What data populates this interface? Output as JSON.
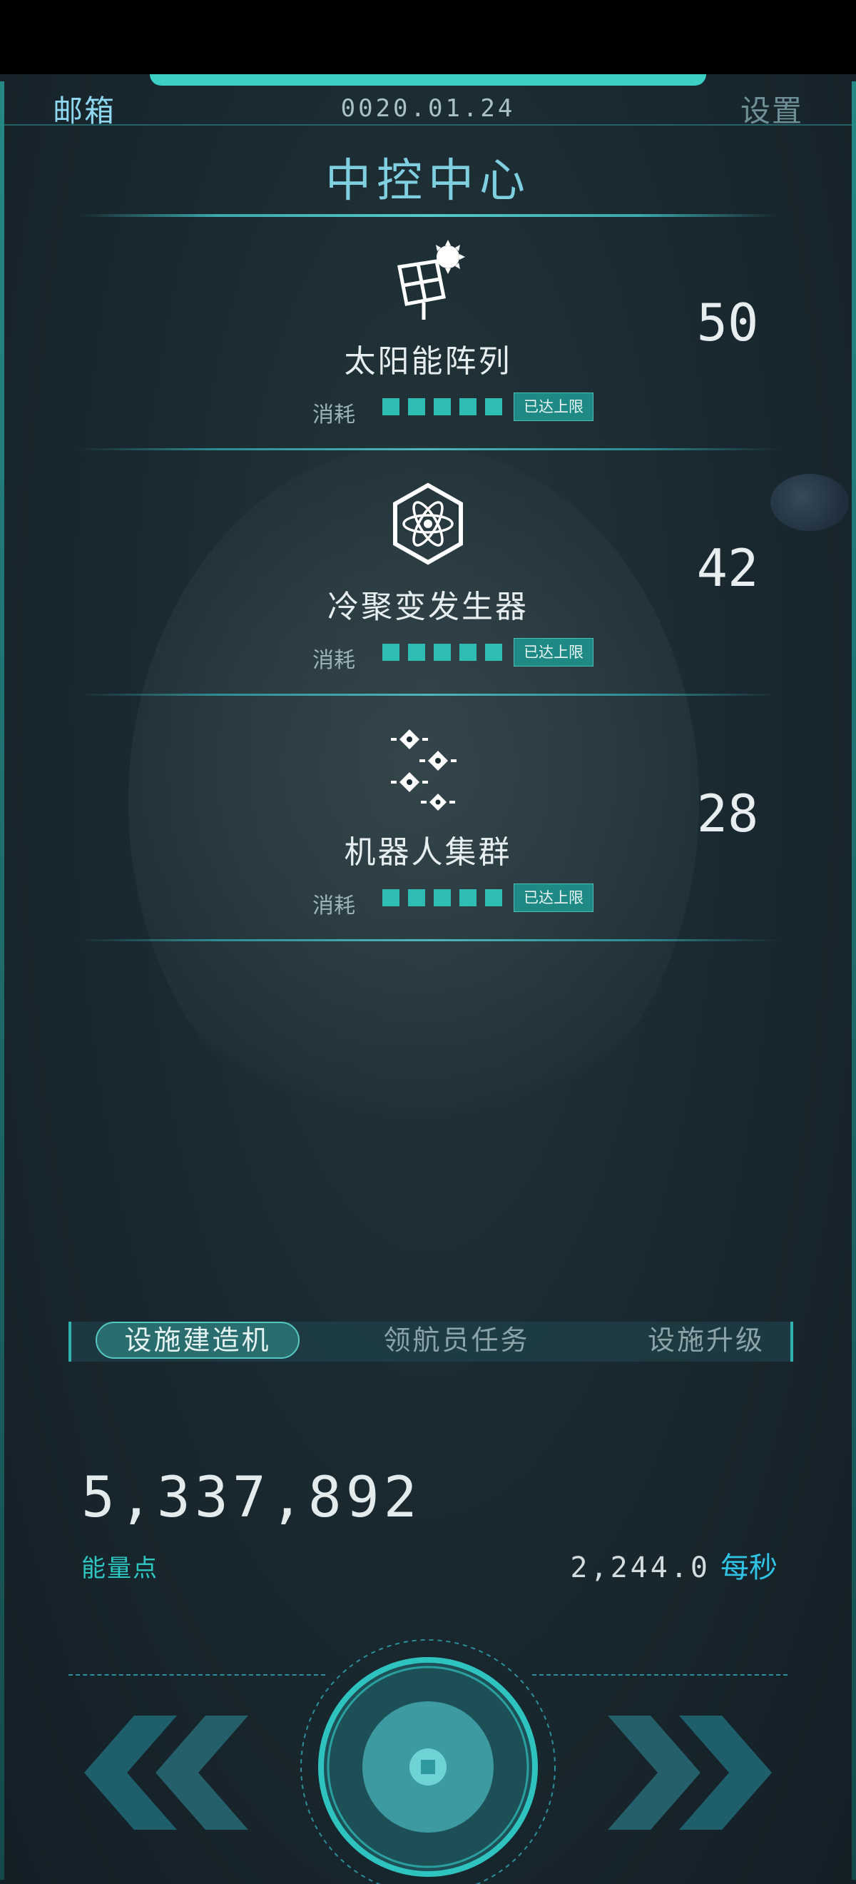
{
  "header": {
    "mail_label": "邮箱",
    "date": "0020.01.24",
    "settings_label": "设置",
    "title": "中控中心"
  },
  "facilities": [
    {
      "name": "太阳能阵列",
      "count": "50",
      "consumption_label": "消耗",
      "consumption_level": 5,
      "badge": "已达上限",
      "icon": "solar-panel-icon"
    },
    {
      "name": "冷聚变发生器",
      "count": "42",
      "consumption_label": "消耗",
      "consumption_level": 5,
      "badge": "已达上限",
      "icon": "atom-icon"
    },
    {
      "name": "机器人集群",
      "count": "28",
      "consumption_label": "消耗",
      "consumption_level": 5,
      "badge": "已达上限",
      "icon": "robot-swarm-icon"
    }
  ],
  "tabs": [
    {
      "label": "设施建造机",
      "active": true
    },
    {
      "label": "领航员任务",
      "active": false
    },
    {
      "label": "设施升级",
      "active": false
    }
  ],
  "energy": {
    "value": "5,337,892",
    "label": "能量点",
    "rate_value": "2,244.0",
    "rate_unit": "每秒"
  },
  "controls": {
    "left_icon": "double-chevron-left-icon",
    "right_icon": "double-chevron-right-icon",
    "center_icon": "core-button-icon"
  },
  "colors": {
    "accent": "#2fbcb2",
    "background": "#1a2a31",
    "title": "#7fcfe0",
    "rate_unit": "#2fc3e6"
  }
}
